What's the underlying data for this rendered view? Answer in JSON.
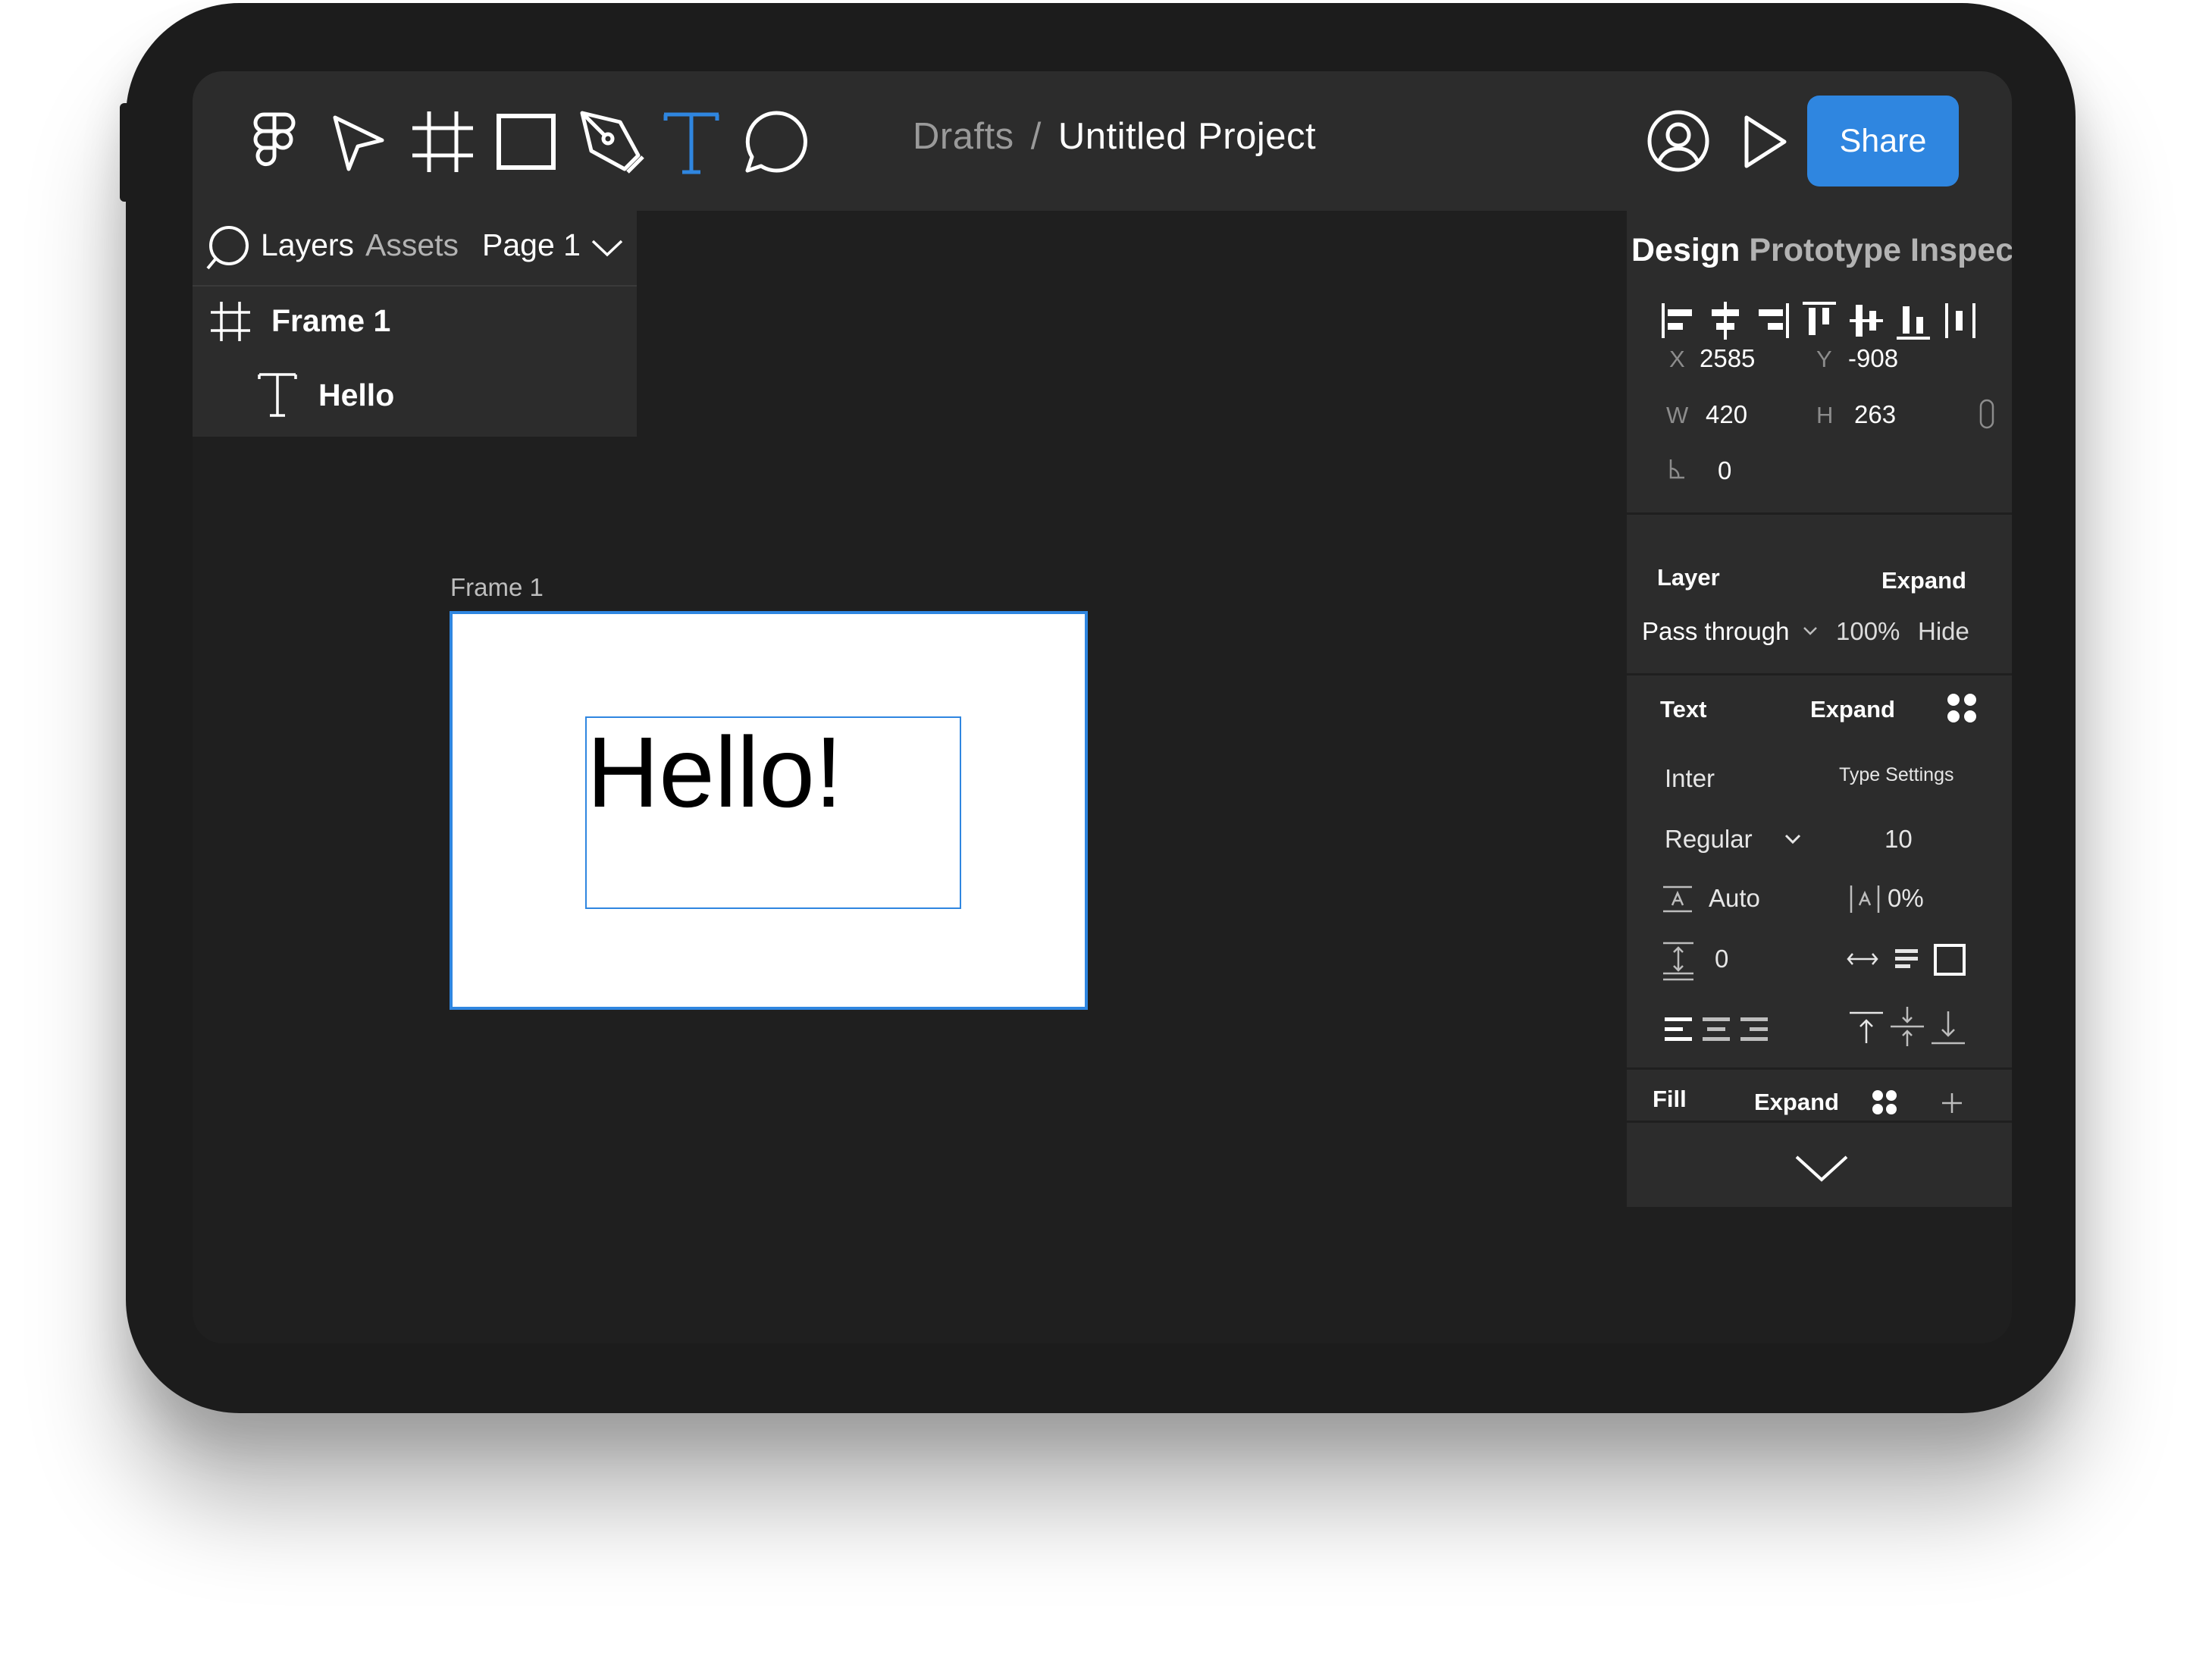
{
  "toolbar": {
    "tools": [
      {
        "name": "figma-logo-icon",
        "color": "#ffffff"
      },
      {
        "name": "move-tool-icon",
        "color": "#ffffff"
      },
      {
        "name": "frame-tool-icon",
        "color": "#ffffff"
      },
      {
        "name": "rectangle-tool-icon",
        "color": "#ffffff"
      },
      {
        "name": "pen-tool-icon",
        "color": "#ffffff"
      },
      {
        "name": "text-tool-icon",
        "color": "#2f86e0",
        "active": true
      },
      {
        "name": "comment-tool-icon",
        "color": "#ffffff"
      }
    ],
    "breadcrumb_parent": "Drafts",
    "breadcrumb_separator": "/",
    "project_title": "Untitled Project",
    "share_label": "Share",
    "accent_color": "#2f86e0"
  },
  "left_panel": {
    "tabs": [
      {
        "label": "Layers",
        "active": true
      },
      {
        "label": "Assets",
        "active": false
      }
    ],
    "page_selector": "Page 1",
    "layers": [
      {
        "label": "Frame 1",
        "icon": "frame-icon",
        "depth": 0
      },
      {
        "label": "Hello",
        "icon": "text-layer-icon",
        "depth": 1
      }
    ]
  },
  "canvas": {
    "frame_label": "Frame 1",
    "text_content": "Hello!",
    "background": "#1f1f1f"
  },
  "right_panel": {
    "tabs": [
      {
        "label": "Design",
        "active": true
      },
      {
        "label": "Prototype",
        "active": false
      },
      {
        "label": "Inspect",
        "active": false
      }
    ],
    "transform": {
      "x_label": "X",
      "x_value": "2585",
      "y_label": "Y",
      "y_value": "-908",
      "w_label": "W",
      "w_value": "420",
      "h_label": "H",
      "h_value": "263",
      "rotation_value": "0"
    },
    "layer": {
      "title": "Layer",
      "expand_label": "Expand",
      "blend_mode": "Pass through",
      "opacity": "100%",
      "hide_label": "Hide"
    },
    "text": {
      "title": "Text",
      "expand_label": "Expand",
      "font_family": "Inter",
      "type_settings_label": "Type Settings",
      "font_weight": "Regular",
      "font_size": "10",
      "line_height": "Auto",
      "letter_spacing": "0%",
      "paragraph_spacing": "0"
    },
    "fill": {
      "title": "Fill",
      "expand_label": "Expand"
    }
  }
}
